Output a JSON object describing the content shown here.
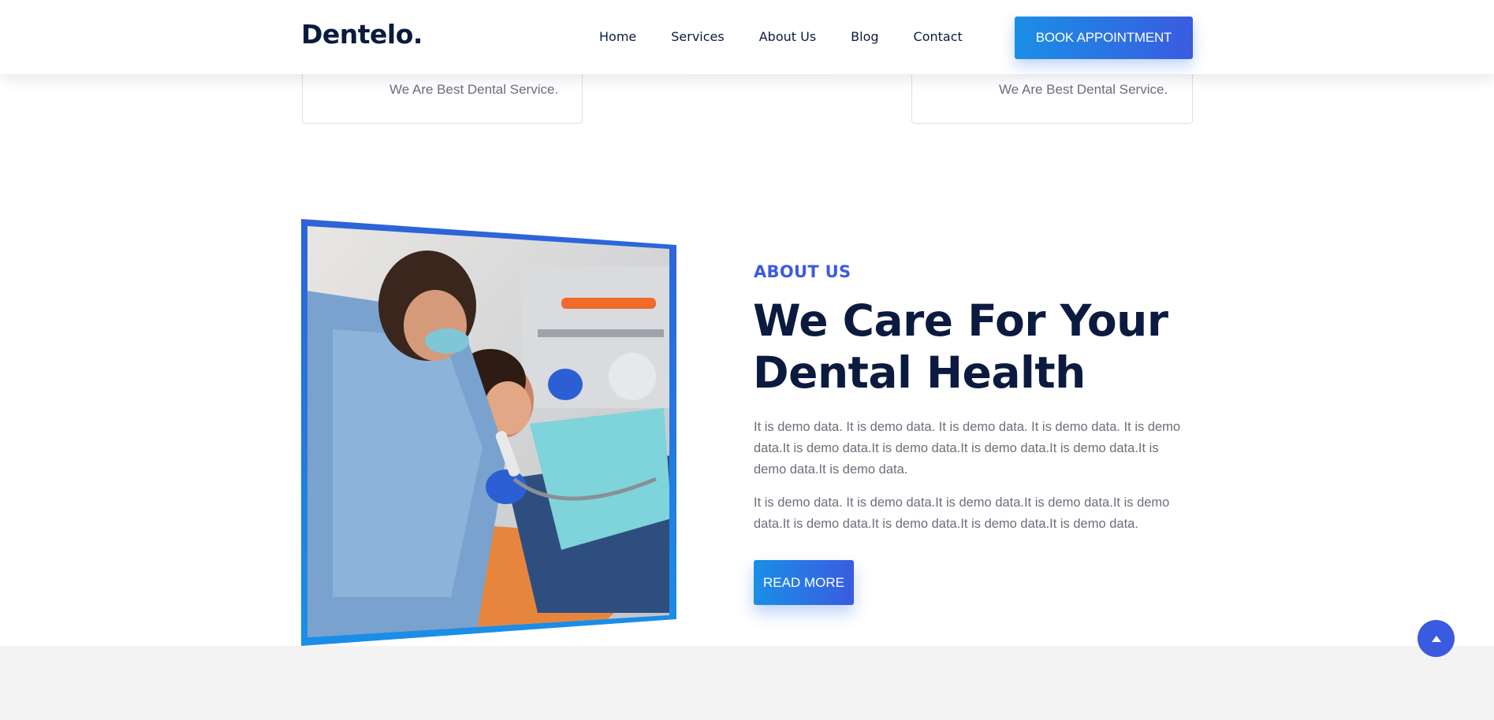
{
  "brand": {
    "logo": "Dentelo."
  },
  "nav": {
    "items": [
      "Home",
      "Services",
      "About Us",
      "Blog",
      "Contact"
    ],
    "cta_label": "BOOK APPOINTMENT"
  },
  "service_cards": {
    "left_tagline": "We Are Best Dental Service.",
    "right_tagline": "We Are Best Dental Service."
  },
  "about": {
    "label": "ABOUT US",
    "title_line1": "We Care For Your",
    "title_line2": "Dental Health",
    "paragraph1": "It is demo data. It is demo data. It is demo data. It is demo data. It is demo data.It is demo data.It is demo data.It is demo data.It is demo data.It is demo data.It is demo data.",
    "paragraph2": "It is demo data. It is demo data.It is demo data.It is demo data.It is demo data.It is demo data.It is demo data.It is demo data.It is demo data.",
    "button_label": "READ MORE",
    "image_icon": "dentist-photo"
  },
  "scroll_top": {
    "icon": "arrow-up-icon"
  },
  "colors": {
    "accent": "#3a5be0",
    "accent_light": "#1a8fe6",
    "heading": "#0b1b3f",
    "body_text": "#6b6f7a",
    "band": "#f3f3f4"
  }
}
